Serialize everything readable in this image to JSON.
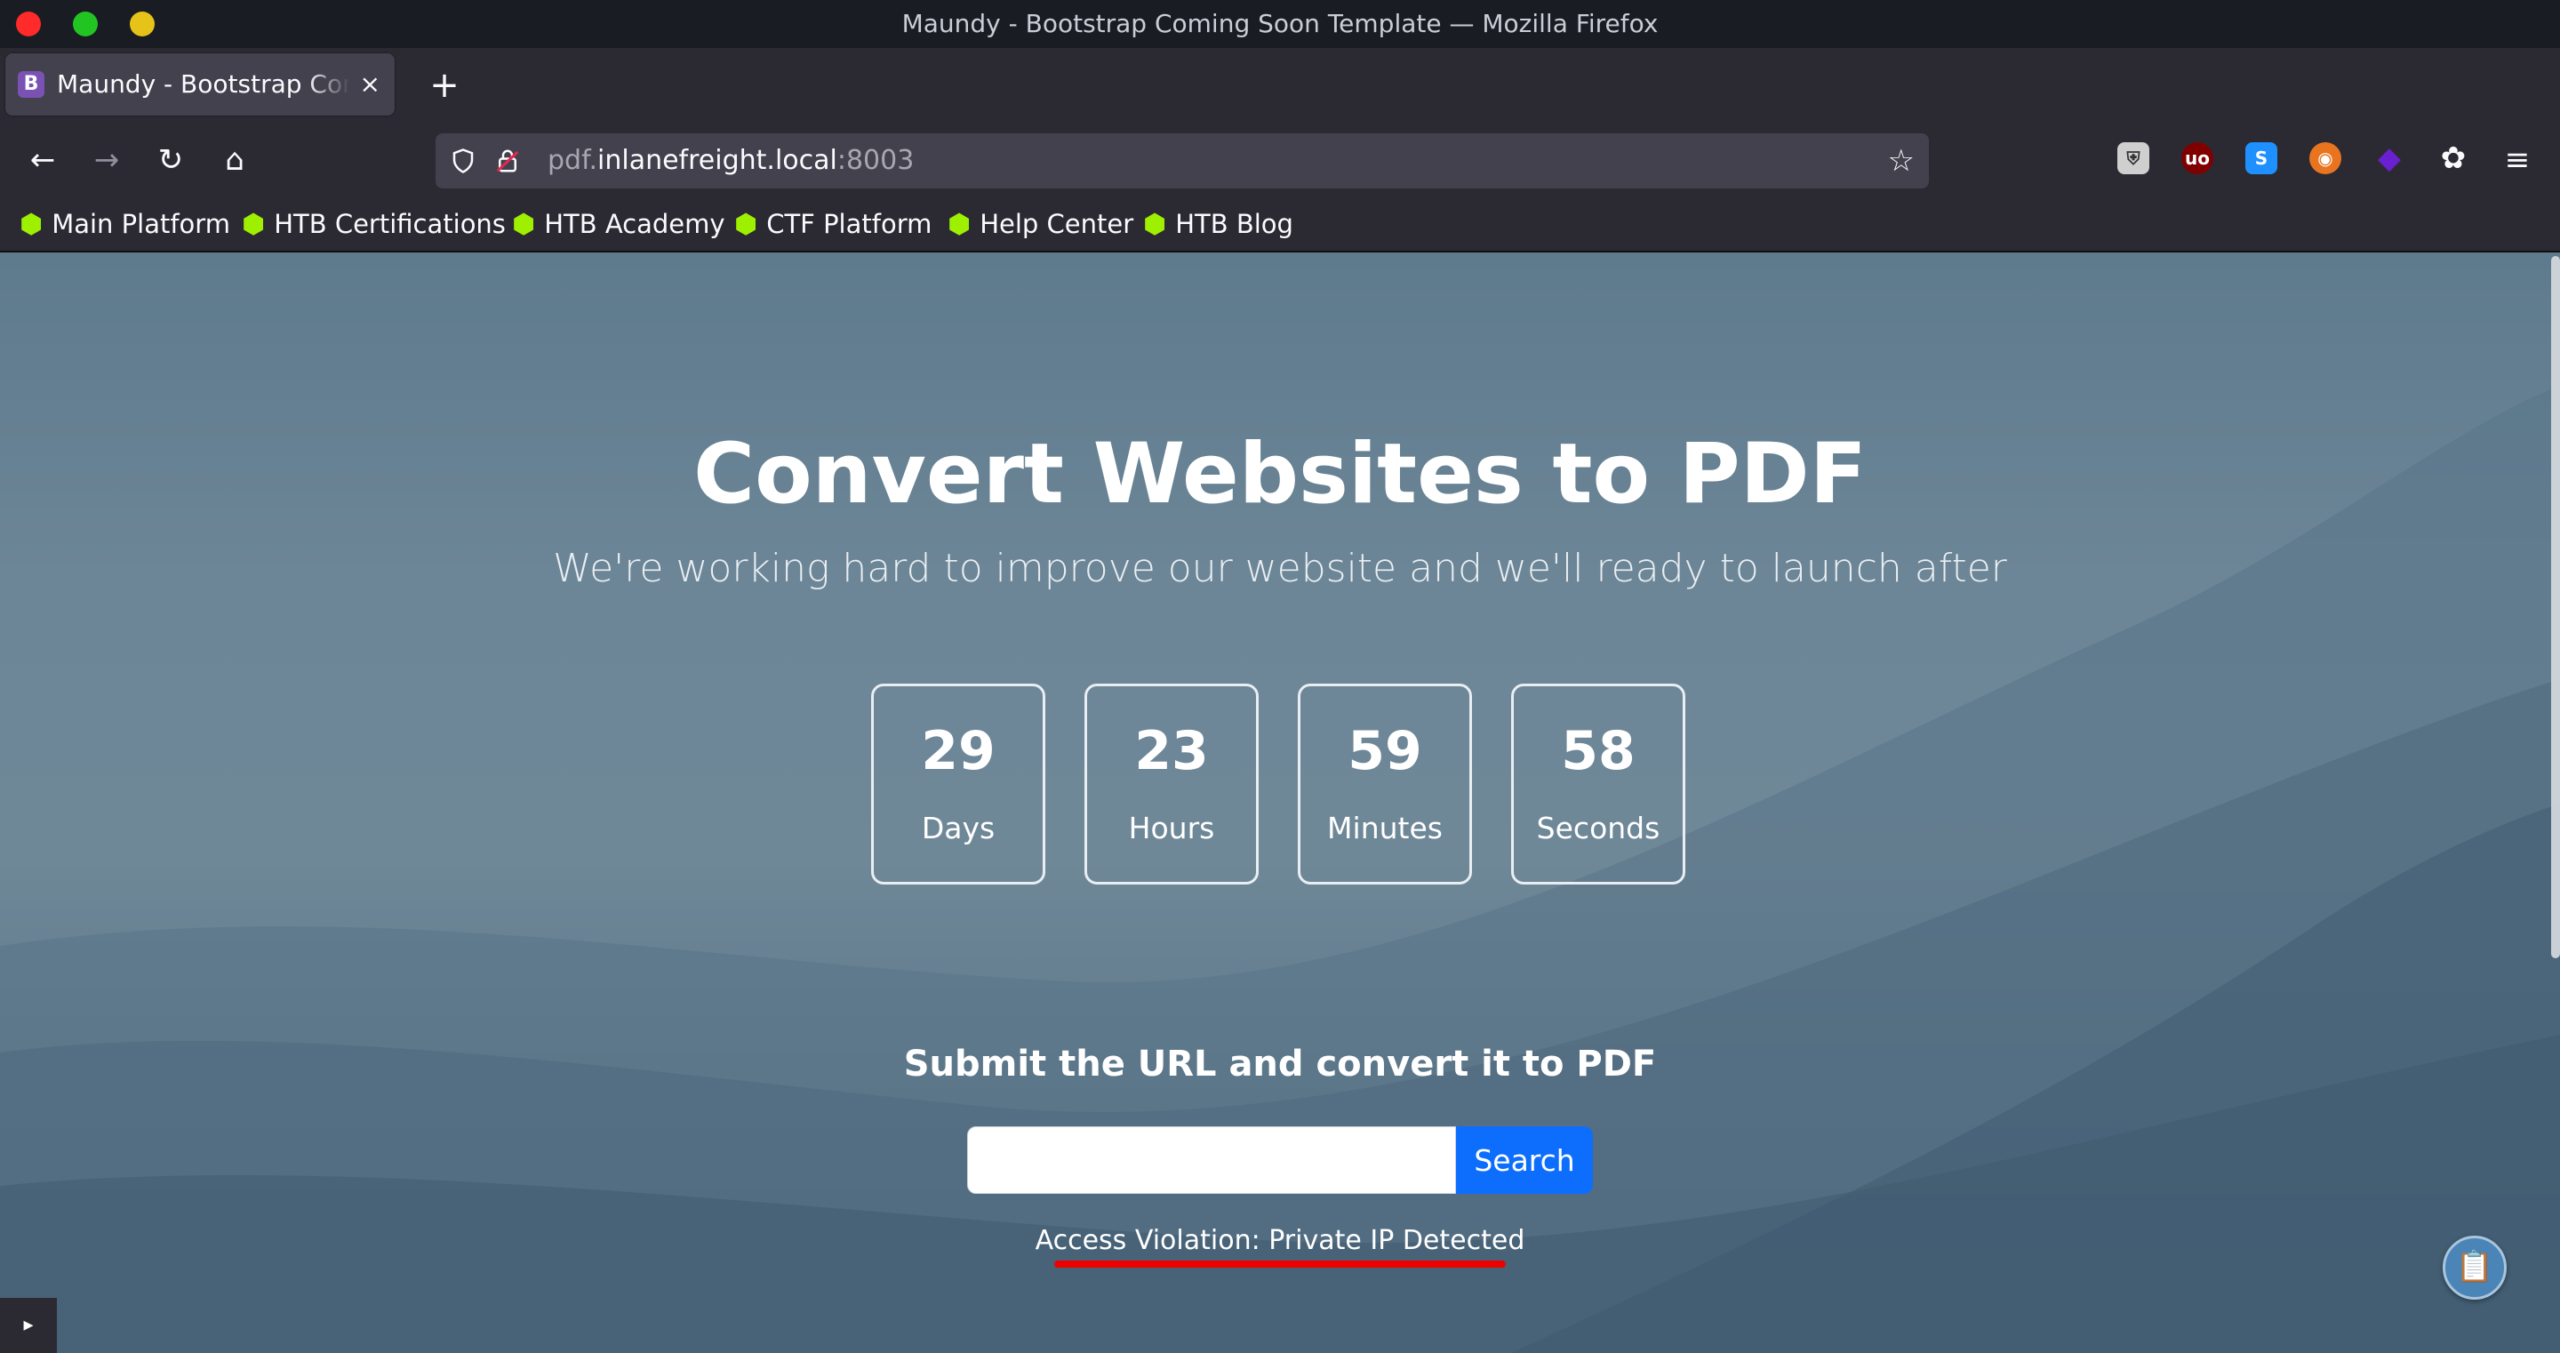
{
  "window": {
    "title": "Maundy - Bootstrap Coming Soon Template — Mozilla Firefox"
  },
  "tab": {
    "favicon_letter": "B",
    "title": "Maundy - Bootstrap Coming Soon Template",
    "close_glyph": "×"
  },
  "newtab_glyph": "+",
  "toolbar": {
    "back_glyph": "←",
    "forward_glyph": "→",
    "reload_glyph": "↻",
    "home_glyph": "⌂",
    "menu_glyph": "≡"
  },
  "urlbar": {
    "host_prefix": "pdf.",
    "host_domain": "inlanefreight.local",
    "port": ":8003",
    "bookmark_glyph": "☆"
  },
  "extensions": [
    {
      "icon": "mask-icon",
      "glyph": "🦊",
      "color": "#cfcfcf"
    },
    {
      "icon": "ublock-icon",
      "glyph": "uo",
      "color": "#800000"
    },
    {
      "icon": "s-icon",
      "glyph": "S",
      "color": "#1e90ff"
    },
    {
      "icon": "fox-icon",
      "glyph": "◉",
      "color": "#e8741f"
    },
    {
      "icon": "gem-icon",
      "glyph": "◆",
      "color": "#6a1fd1"
    },
    {
      "icon": "cookie-icon",
      "glyph": "✿",
      "color": "#42414d"
    }
  ],
  "bookmarks": [
    {
      "label": "Main Platform"
    },
    {
      "label": "HTB Certifications"
    },
    {
      "label": "HTB Academy"
    },
    {
      "label": "CTF Platform"
    },
    {
      "label": "Help Center"
    },
    {
      "label": "HTB Blog"
    }
  ],
  "page": {
    "heading": "Convert Websites to PDF",
    "subheading": "We're working hard to improve our website and we'll ready to launch after",
    "countdown": [
      {
        "value": "29",
        "label": "Days"
      },
      {
        "value": "23",
        "label": "Hours"
      },
      {
        "value": "59",
        "label": "Minutes"
      },
      {
        "value": "58",
        "label": "Seconds"
      }
    ],
    "form_label": "Submit the URL and convert it to PDF",
    "search_value": "",
    "search_button": "Search",
    "error_message": "Access Violation: Private IP Detected"
  },
  "colors": {
    "accent": "#0d6efd",
    "error_underline": "#ee0000",
    "bookmark_icon": "#9fef00"
  }
}
